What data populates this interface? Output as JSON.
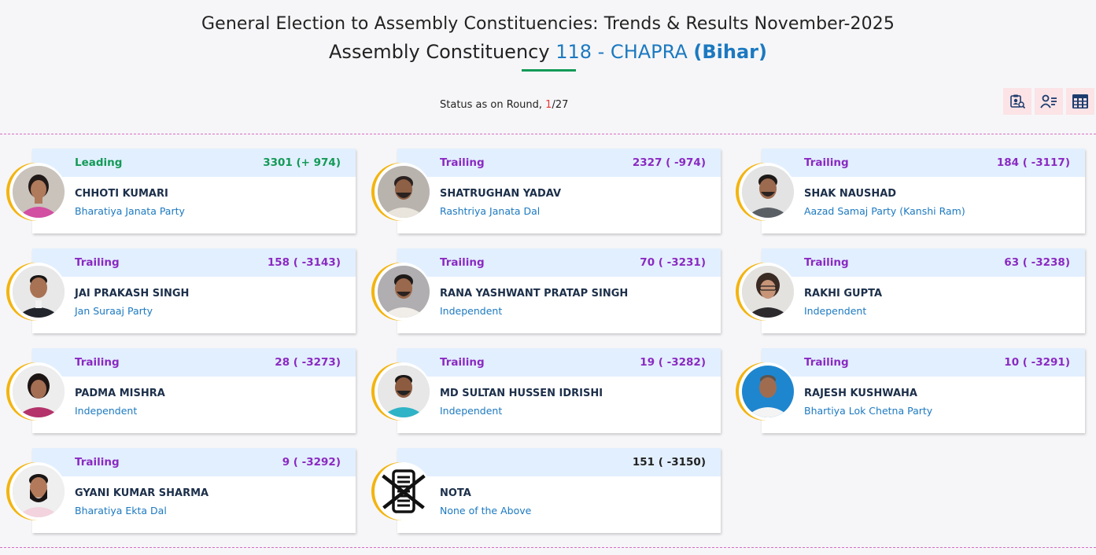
{
  "header": {
    "title_line1": "General Election to Assembly Constituencies: Trends & Results November-2025",
    "title_line2_prefix": "Assembly Constituency",
    "constituency": "118 - CHAPRA",
    "state": "(Bihar)"
  },
  "status": {
    "prefix": "Status as on Round,",
    "current_round": "1",
    "total_rounds": "/27"
  },
  "toolbar": {
    "icons": [
      "candidate-search-icon",
      "candidate-list-icon",
      "table-view-icon"
    ]
  },
  "colors": {
    "leading": "#139a57",
    "trailing": "#8a2ac1",
    "party": "#1c79c0",
    "card_header": "#e2efff",
    "ring": "#f3b40f"
  },
  "candidates": [
    {
      "status": "Leading",
      "votes": "3301 (+ 974)",
      "name": "CHHOTI KUMARI",
      "party": "Bharatiya Janata Party"
    },
    {
      "status": "Trailing",
      "votes": "2327 ( -974)",
      "name": "SHATRUGHAN YADAV",
      "party": "Rashtriya Janata Dal"
    },
    {
      "status": "Trailing",
      "votes": "184 ( -3117)",
      "name": "SHAK NAUSHAD",
      "party": "Aazad Samaj Party (Kanshi Ram)"
    },
    {
      "status": "Trailing",
      "votes": "158 ( -3143)",
      "name": "JAI PRAKASH SINGH",
      "party": "Jan Suraaj Party"
    },
    {
      "status": "Trailing",
      "votes": "70 ( -3231)",
      "name": "RANA YASHWANT PRATAP SINGH",
      "party": "Independent"
    },
    {
      "status": "Trailing",
      "votes": "63 ( -3238)",
      "name": "RAKHI GUPTA",
      "party": "Independent"
    },
    {
      "status": "Trailing",
      "votes": "28 ( -3273)",
      "name": "PADMA MISHRA",
      "party": "Independent"
    },
    {
      "status": "Trailing",
      "votes": "19 ( -3282)",
      "name": "MD SULTAN HUSSEN IDRISHI",
      "party": "Independent"
    },
    {
      "status": "Trailing",
      "votes": "10 ( -3291)",
      "name": "RAJESH KUSHWAHA",
      "party": "Bhartiya Lok Chetna Party"
    },
    {
      "status": "Trailing",
      "votes": "9 ( -3292)",
      "name": "GYANI KUMAR SHARMA",
      "party": "Bharatiya Ekta Dal"
    },
    {
      "status": "",
      "votes": "151 ( -3150)",
      "name": "NOTA",
      "party": "None of the Above"
    }
  ]
}
